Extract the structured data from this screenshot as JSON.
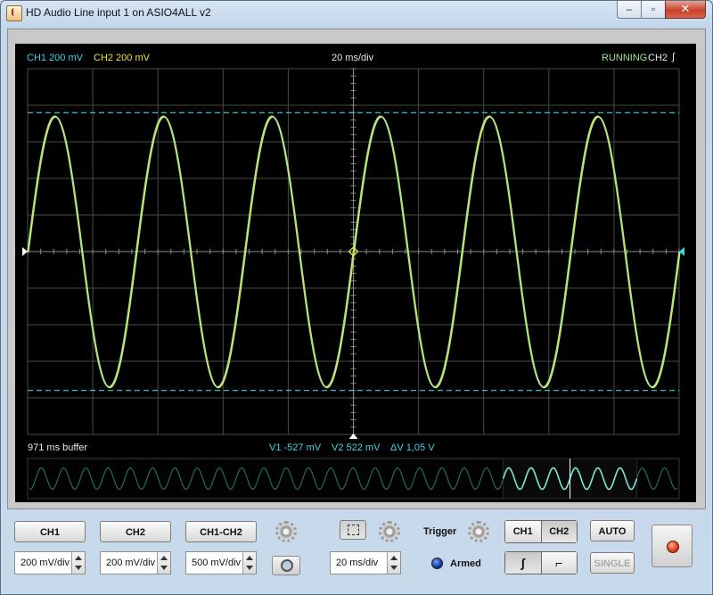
{
  "window": {
    "title": "HD Audio Line input 1 on ASIO4ALL v2",
    "min_glyph": "–",
    "max_glyph": "▫",
    "close_glyph": "✕"
  },
  "scope": {
    "ch1_scale": "CH1 200 mV",
    "ch2_scale": "CH2 200 mV",
    "timebase": "20 ms/div",
    "status": "RUNNING",
    "trigger_source": "CH2",
    "trigger_slope_glyph": "∫",
    "buffer": "971 ms buffer",
    "v1": "V1 -527 mV",
    "v2": "V2 522 mV",
    "delta_v": "ΔV 1,05 V",
    "signal": {
      "cycles_on_screen": 6,
      "peak_fraction": 0.74
    },
    "colors": {
      "ch1": "#38d7e6",
      "ch2": "#e8e63a",
      "trace": "#9ee79a",
      "grid": "#4a4a4a"
    }
  },
  "controls": {
    "ch1_button": "CH1",
    "ch2_button": "CH2",
    "ch1_minus_ch2_button": "CH1-CH2",
    "ch1_volts": "200 mV/div",
    "ch2_volts": "200 mV/div",
    "math_volts": "500 mV/div",
    "time_div": "20 ms/div",
    "trigger_label": "Trigger",
    "armed_label": "Armed",
    "trig_ch1": "CH1",
    "trig_ch2": "CH2",
    "rising_glyph": "∫",
    "falling_glyph": "⌐",
    "auto_button": "AUTO",
    "single_button": "SINGLE"
  }
}
